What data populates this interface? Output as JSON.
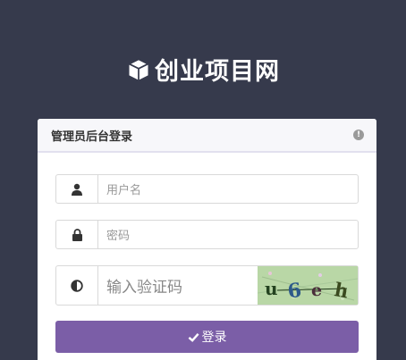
{
  "brand": {
    "title": "创业项目网",
    "icon": "cube-icon"
  },
  "login_panel": {
    "title": "管理员后台登录",
    "info_icon": "exclamation-circle-icon"
  },
  "form": {
    "username": {
      "placeholder": "用户名",
      "icon": "user-icon"
    },
    "password": {
      "placeholder": "密码",
      "icon": "lock-icon"
    },
    "captcha": {
      "placeholder": "输入验证码",
      "icon": "half-circle-icon",
      "captcha_text": "u6eh"
    },
    "submit": {
      "label": "登录",
      "icon": "check-icon"
    }
  },
  "colors": {
    "background": "#363a4c",
    "panel_header": "#f7f7fa",
    "button": "#7b5ea7"
  }
}
